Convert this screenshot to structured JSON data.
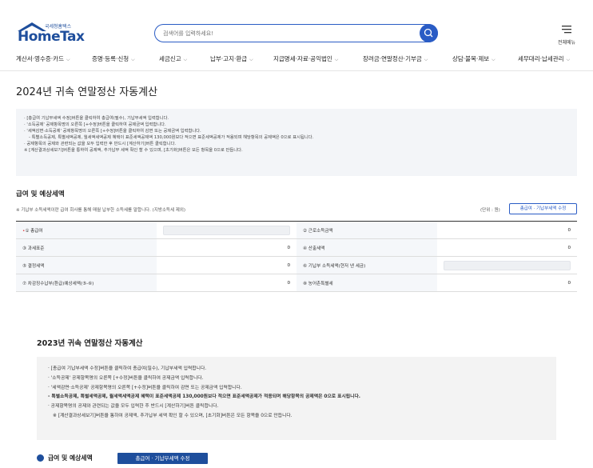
{
  "header": {
    "logo_small": "국세청홈택스",
    "logo_brand": "HomeTax",
    "search_placeholder": "검색어를 입력하세요!",
    "all_menu_label": "전체메뉴"
  },
  "gnb": [
    "계산서·영수증·카드",
    "증명·등록·신청",
    "세금신고",
    "납부·고지·환급",
    "지급명세·자료·공익법인",
    "장려금·연말정산·기부금",
    "상담·불복·제보",
    "세무대리·납세관리"
  ],
  "page_title": "2024년 귀속 연말정산 자동계산",
  "guide_2024": [
    "· [총급여 기납부세액 수정]버튼을 클릭하여 총급여(필수), 기납부세액 입력합니다.",
    "· '소득공제' 공제항목명의 오른쪽 [+수정]버튼을 클릭하여 공제금액 입력합니다.",
    "· '세액감면·소득공제' 공제항목명의 오른쪽 [+수정]버튼을 클릭하여 감면 또는 공제금액 입력합니다.",
    "  - 특별소득공제, 특별세액공제, 월세액세액공제 혜택이 표준세액공제액 130,000원보다 적으면 표준세액공제가 적용되며 해당항목의 공제액은 0으로 표시됩니다.",
    "· 공제항목의 공제와 관련되는 값을 모두 입력한 후 반드시 [계산하기]버튼 클릭합니다.",
    "※ [계산결과상세보기]버튼을 통하여 공제액, 추가납부 세액 확인 할 수 있으며, [초기화]버튼은 모든 항목을 0으로 만듭니다."
  ],
  "section": {
    "title": "급여 및 예상세액",
    "note": "※ 기납부 소득세액이란 급여 회사를 통해 매월 납부한 소득세를 말합니다. (지방소득세 제외)",
    "unit": "(단위 : 원)",
    "edit_button": "총급여 · 기납부세액 수정"
  },
  "table": {
    "rows": [
      {
        "l_label": "① 총급여",
        "l_required": "•",
        "l_value": "",
        "r_label": "② 근로소득금액",
        "r_value": "0"
      },
      {
        "l_label": "③ 과세표준",
        "l_value": "0",
        "r_label": "④ 산출세액",
        "r_value": "0"
      },
      {
        "l_label": "⑤ 결정세액",
        "l_value": "0",
        "r_label": "⑥ 기납부 소득세액(현저 낸 세금)",
        "r_value": ""
      },
      {
        "l_label": "⑦ 차감징수납부(환급)예상세액(⑤-⑥)",
        "l_value": "0",
        "r_label": "⑧ 농어촌특별세",
        "r_value": "0"
      }
    ]
  },
  "prev_year": {
    "title": "2023년 귀속 연말정산 자동계산",
    "guide": [
      "· [총급여 기납부세액 수정]버튼을 클릭하여 총급여(필수), 기납부세액 입력합니다.",
      "· '소득공제' 공제항목명의 오른쪽 [+수정]버튼을 클릭하여 공제금액 입력합니다.",
      "· '세액감면·소득공제' 공제항목명의 오른쪽 [+수정]버튼을 클릭하여 감면 또는 공제금액 입력합니다.",
      "- 특별소득공제, 특별세액공제, 월세액세액공제 혜택이 표준세액공제 130,000원보다 적으면 표준세액공제가 적용되며 해당항목의 공제액은 0으로 표시됩니다.",
      "· 공제항목명의 공제와 관련되는 값을 모두 입력한 후 반드시 [계산하기]버튼 클릭합니다.",
      "※ [계산결과상세보기]버튼을 통하여 공제액, 추가납부 세액 확인 할 수 있으며, [초기화]버튼은 모든 항목을 0으로 만듭니다."
    ],
    "section_title": "급여 및 예상세액",
    "edit_button": "총급여 · 기납부세액 수정"
  },
  "colors": {
    "brand": "#1e4e9c",
    "accent": "#2a5cc5",
    "required": "#dd3333"
  },
  "icons": [
    "hometax-roof-icon",
    "search-icon",
    "hamburger-menu-icon",
    "chevron-down-icon"
  ]
}
